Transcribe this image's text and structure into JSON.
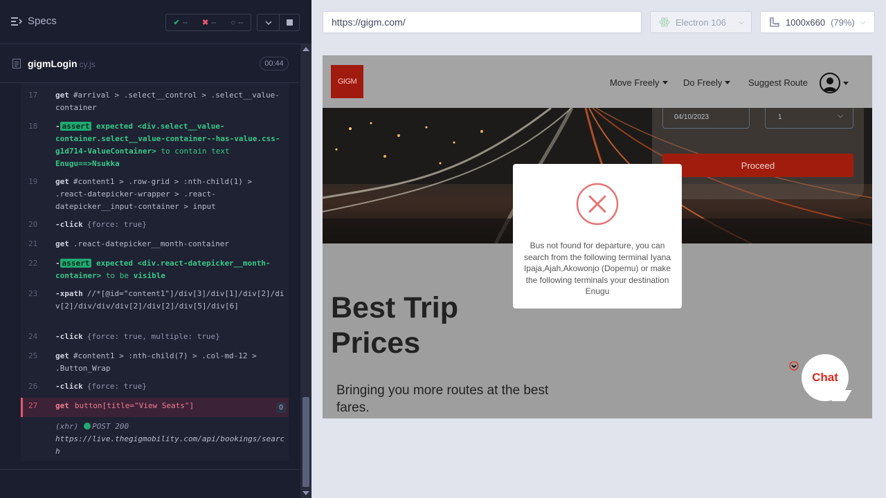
{
  "runner": {
    "specs_label": "Specs",
    "stats": {
      "passed": "--",
      "failed": "--",
      "pending": "--"
    },
    "spec_file": {
      "name": "gigmLogin",
      "ext": "cy.js",
      "duration": "00:44"
    }
  },
  "commands": [
    {
      "num": "17",
      "kw": "get",
      "text": "#arrival > .select__control > .select__value-container"
    },
    {
      "num": "18",
      "badge": "assert",
      "pre": "expected ",
      "el": "<div.select__value-container.select__value-container--has-value.css-g1d714-ValueContainer>",
      "mid": " to contain text ",
      "val": "Enugu==>Nsukka"
    },
    {
      "num": "19",
      "kw": "get",
      "text": "#content1 > .row-grid > :nth-child(1) > .react-datepicker-wrapper > .react-datepicker__input-container > input"
    },
    {
      "num": "20",
      "kw": "click",
      "text": "{force: true}"
    },
    {
      "num": "21",
      "kw": "get",
      "text": ".react-datepicker__month-container"
    },
    {
      "num": "22",
      "badge": "assert",
      "pre": "expected ",
      "el": "<div.react-datepicker__month-container>",
      "mid": " to be ",
      "val": "visible"
    },
    {
      "num": "23",
      "kw": "xpath",
      "text": "//*[@id=\"content1\"]/div[3]/div[1]/div[2]/div[2]/div/div/div[2]/div[2]/div[5]/div[6]"
    },
    {
      "num": "24",
      "kw": "click",
      "text": "{force: true, multiple: true}"
    },
    {
      "num": "25",
      "kw": "get",
      "text": "#content1 > :nth-child(7) > .col-md-12 > .Button_Wrap"
    },
    {
      "num": "26",
      "kw": "click",
      "text": "{force: true}"
    }
  ],
  "active_command": {
    "num": "27",
    "kw": "get",
    "text": "button[title=\"View Seats\"]",
    "count": "0"
  },
  "xhr": {
    "tag": "(xhr)",
    "method_status": "POST 200",
    "url": "https://live.thegigmobility.com/api/bookings/search"
  },
  "aut": {
    "url": "https://gigm.com/",
    "browser": "Electron 106",
    "viewport": "1000x660",
    "zoom": "(79%)"
  },
  "site": {
    "logo": "GIGM",
    "nav": [
      "Move Freely",
      "Do Freely",
      "Suggest Route"
    ],
    "date_value": "04/10/2023",
    "qty_value": "1",
    "proceed_label": "Proceed",
    "hero_title_1": "Best Trip",
    "hero_title_2": "Prices",
    "hero_sub": "Bringing you more routes at the best fares.",
    "chat_label": "Chat"
  },
  "modal": {
    "message": "Bus not found for departure, you can search from the following terminal Iyana Ipaja,Ajah,Akowonjo (Dopemu) or make the following terminals your destination Enugu"
  },
  "colors": {
    "runner_bg": "#1b1e2e",
    "assert_green": "#1fa971",
    "active_red": "#e45770",
    "gigm_red": "#a11a0f",
    "modal_error": "#e57373"
  }
}
